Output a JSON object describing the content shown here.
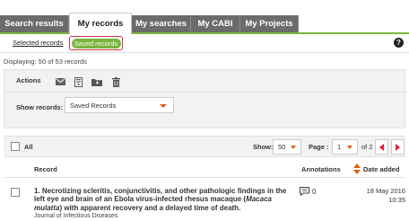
{
  "tabs": [
    {
      "label": "Search results",
      "active": false
    },
    {
      "label": "My records",
      "active": true
    },
    {
      "label": "My searches",
      "active": false
    },
    {
      "label": "My CABI",
      "active": false
    },
    {
      "label": "My Projects",
      "active": false
    }
  ],
  "subnav": {
    "selected_records": "Selected records",
    "saved_records": "Saved records",
    "help_icon": "?"
  },
  "displaying": "Displaying: 50 of 53 records",
  "actions": {
    "label": "Actions",
    "icons": [
      "email-icon",
      "export-icon",
      "folder-icon",
      "trash-icon"
    ]
  },
  "show_records": {
    "label": "Show records:",
    "value": "Saved Records"
  },
  "results_bar": {
    "all_label": "All",
    "show_label": "Show:",
    "show_value": "50",
    "page_label": "Page :",
    "page_value": "1",
    "of_label": "of 2"
  },
  "columns": {
    "record": "Record",
    "annotations": "Annotations",
    "date_added": "Date added"
  },
  "records": [
    {
      "title_pre": "1. Necrotizing scleritis, conjunctivitis, and other pathologic findings in the left eye and brain of an Ebola virus-infected rhesus macaque (",
      "title_italic": "Macaca mulatta",
      "title_post": ") with apparent recovery and a delayed time of death.",
      "journal": "Journal of Infectious Diseases",
      "annotations": "0",
      "date": "18 May 2016",
      "time": "10:35"
    }
  ],
  "colors": {
    "tab_bg": "#6b6b6b",
    "accent_green": "#7ab43d",
    "highlight_red": "#d63340",
    "pager_red": "#e02030",
    "caret_orange": "#e05a1a"
  }
}
